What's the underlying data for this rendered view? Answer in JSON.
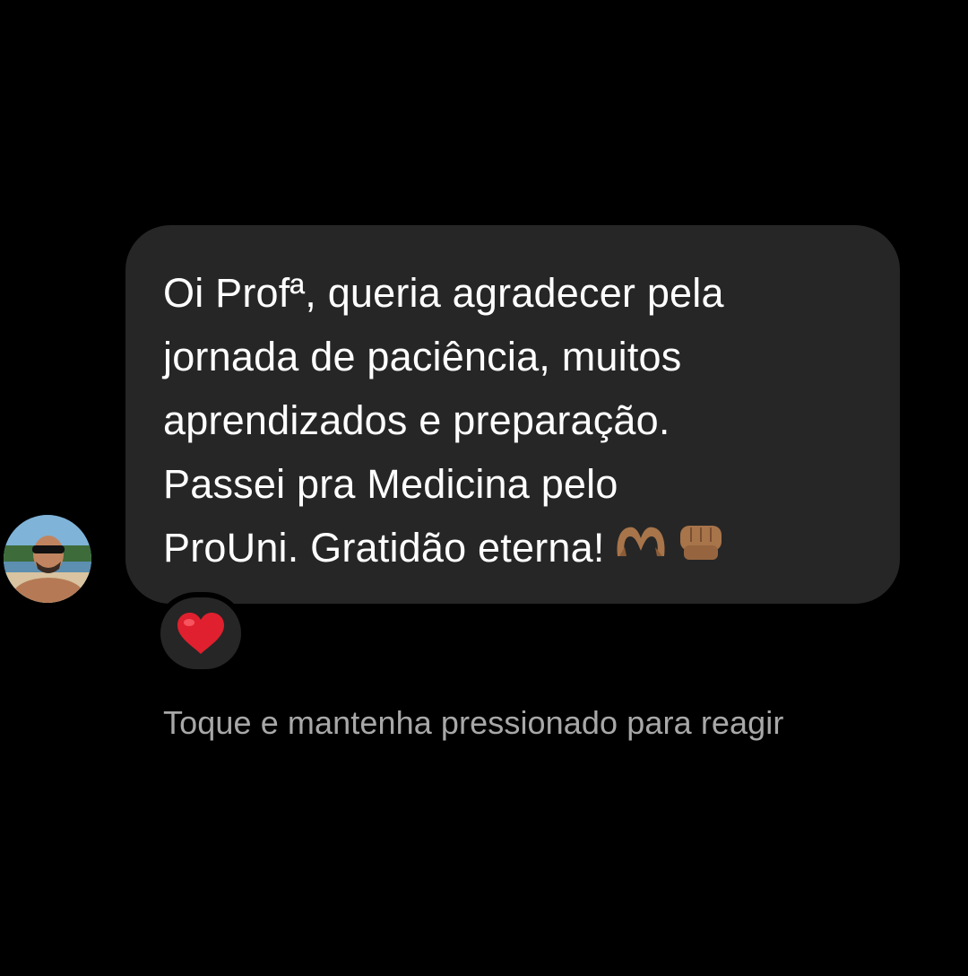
{
  "sender": {
    "avatar_icon": "profile-photo-avatar"
  },
  "message": {
    "text": "Oi Profª, queria agradecer pela\njornada de paciência, muitos\naprendizados e preparação.\nPassei pra Medicina pelo\nProUni. Gratidão eterna!",
    "trailing_emojis": [
      "heart-hands-icon",
      "raised-fist-icon"
    ],
    "bubble_color": "#262626"
  },
  "reaction": {
    "emoji": "red-heart-icon",
    "color": "#e0202e"
  },
  "hint": {
    "text": "Toque e mantenha pressionado para reagir",
    "color": "#a8a8a8"
  }
}
